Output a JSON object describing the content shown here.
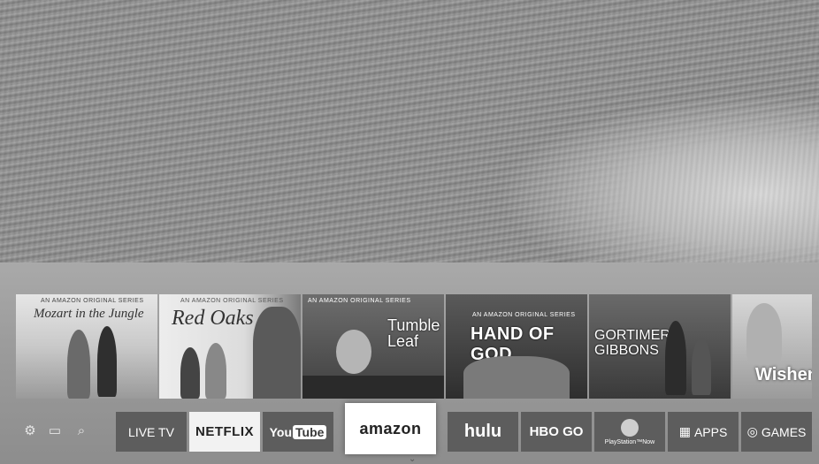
{
  "featured": [
    {
      "kicker": "AN AMAZON ORIGINAL SERIES",
      "title": "Mozart in the Jungle"
    },
    {
      "kicker": "AN AMAZON ORIGINAL SERIES",
      "title": "Red Oaks"
    },
    {
      "kicker": "AN AMAZON ORIGINAL SERIES",
      "title": "Tumble Leaf"
    },
    {
      "kicker": "AN AMAZON ORIGINAL SERIES",
      "title": "HAND OF GOD"
    },
    {
      "kicker": "",
      "title": "GORTIMER GIBBONS"
    },
    {
      "kicker": "",
      "title": "Wishen"
    }
  ],
  "nav_icons": [
    "gear-icon",
    "source-icon",
    "search-icon"
  ],
  "apps": {
    "live_tv": "LIVE TV",
    "netflix": "NETFLIX",
    "youtube_you": "You",
    "youtube_tube": "Tube",
    "amazon": "amazon",
    "hulu": "hulu",
    "hbo": "HBO GO",
    "playstation": "PlayStation™Now",
    "apps": "APPS",
    "games": "GAMES"
  }
}
